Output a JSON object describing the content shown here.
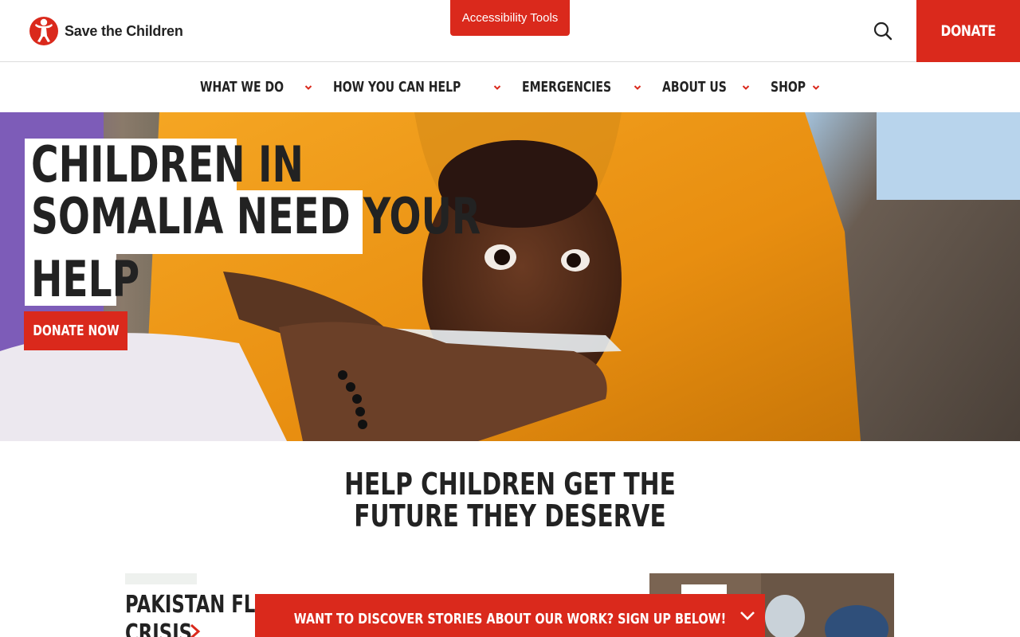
{
  "header": {
    "logo_text": "Save the Children",
    "accessibility_label": "Accessibility Tools",
    "donate_label": "DONATE",
    "brand_color": "#da291c"
  },
  "nav": {
    "items": [
      {
        "label": "WHAT WE DO"
      },
      {
        "label": "HOW YOU CAN HELP"
      },
      {
        "label": "EMERGENCIES"
      },
      {
        "label": "ABOUT US"
      },
      {
        "label": "SHOP"
      }
    ]
  },
  "hero": {
    "title_lines": [
      "CHILDREN IN",
      "SOMALIA NEED YOUR",
      "HELP"
    ],
    "cta_label": "DONATE NOW"
  },
  "main": {
    "section_title": "HELP CHILDREN GET THE FUTURE THEY DESERVE",
    "cards": [
      {
        "title_lines": [
          "PAKISTAN FLOOD",
          "CRISIS"
        ]
      }
    ]
  },
  "signup_banner": {
    "text": "WANT TO DISCOVER STORIES ABOUT OUR WORK? SIGN UP BELOW!"
  }
}
